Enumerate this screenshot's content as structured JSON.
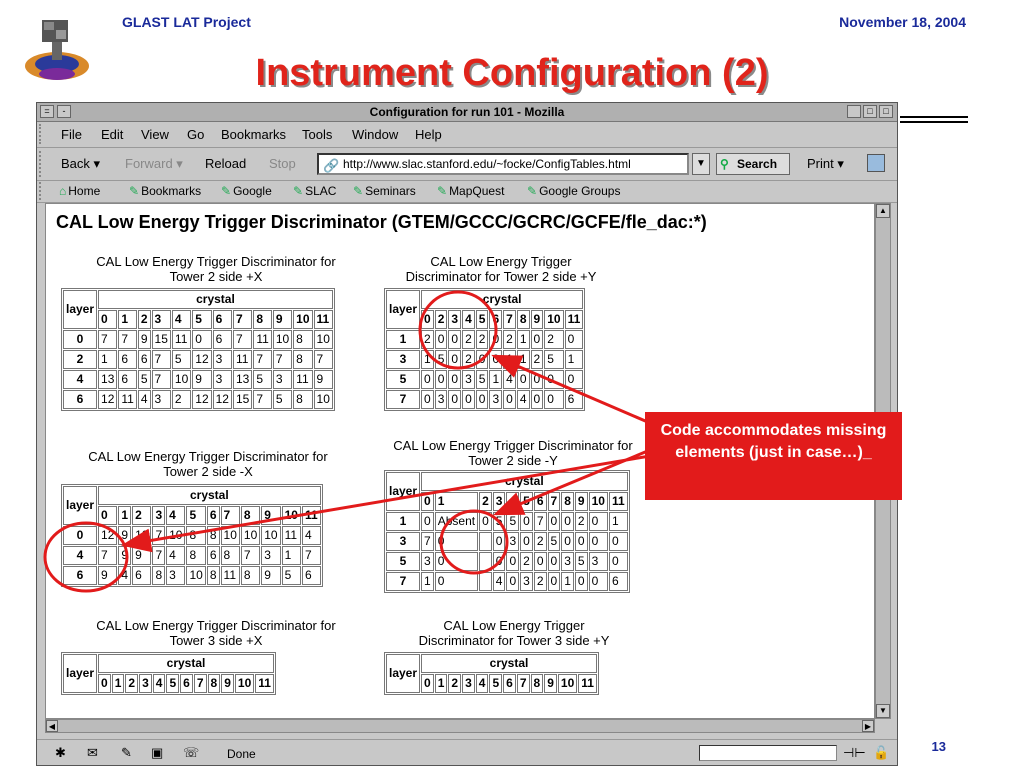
{
  "slide": {
    "left_header": "GLAST LAT Project",
    "right_header": "November 18, 2004",
    "title": "Instrument Configuration (2)",
    "page_number": "13",
    "callout": "Code accommodates missing elements (just in case…)_",
    "accent_color": "#e21b1b"
  },
  "browser": {
    "window_title": "Configuration for run 101 - Mozilla",
    "menu": [
      "File",
      "Edit",
      "View",
      "Go",
      "Bookmarks",
      "Tools",
      "Window",
      "Help"
    ],
    "nav": {
      "back": "Back",
      "forward": "Forward",
      "reload": "Reload",
      "stop": "Stop",
      "print": "Print"
    },
    "url": "http://www.slac.stanford.edu/~focke/ConfigTables.html",
    "search_label": "Search",
    "bookmarks": [
      "Home",
      "Bookmarks",
      "Google",
      "SLAC",
      "Seminars",
      "MapQuest",
      "Google Groups"
    ],
    "status": "Done"
  },
  "page": {
    "heading": "CAL Low Energy Trigger Discriminator (GTEM/GCCC/GCRC/GCFE/fle_dac:*)",
    "layer_label": "layer",
    "crystal_label": "crystal",
    "absent_label": "Absent",
    "tables": [
      {
        "caption": [
          "CAL Low Energy Trigger Discriminator for",
          "Tower 2 side +X"
        ],
        "columns": [
          "0",
          "1",
          "2",
          "3",
          "4",
          "5",
          "6",
          "7",
          "8",
          "9",
          "10",
          "11"
        ],
        "rows": [
          {
            "layer": "0",
            "values": [
              "7",
              "7",
              "9",
              "15",
              "11",
              "0",
              "6",
              "7",
              "11",
              "10",
              "8",
              "10"
            ]
          },
          {
            "layer": "2",
            "values": [
              "1",
              "6",
              "6",
              "7",
              "5",
              "12",
              "3",
              "11",
              "7",
              "7",
              "8",
              "7"
            ]
          },
          {
            "layer": "4",
            "values": [
              "13",
              "6",
              "5",
              "7",
              "10",
              "9",
              "3",
              "13",
              "5",
              "3",
              "11",
              "9"
            ]
          },
          {
            "layer": "6",
            "values": [
              "12",
              "11",
              "4",
              "3",
              "2",
              "12",
              "12",
              "15",
              "7",
              "5",
              "8",
              "10"
            ]
          }
        ]
      },
      {
        "caption": [
          "CAL Low Energy Trigger",
          "Discriminator for Tower 2 side +Y"
        ],
        "columns": [
          "0",
          "2",
          "3",
          "4",
          "5",
          "6",
          "7",
          "8",
          "9",
          "10",
          "11"
        ],
        "rows": [
          {
            "layer": "1",
            "values": [
              "2",
              "0",
              "0",
              "2",
              "2",
              "0",
              "2",
              "1",
              "0",
              "2",
              "0"
            ]
          },
          {
            "layer": "3",
            "values": [
              "1",
              "5",
              "0",
              "2",
              "0",
              "0",
              "1",
              "1",
              "2",
              "5",
              "1"
            ]
          },
          {
            "layer": "5",
            "values": [
              "0",
              "0",
              "0",
              "3",
              "5",
              "1",
              "4",
              "0",
              "0",
              "0",
              "0"
            ]
          },
          {
            "layer": "7",
            "values": [
              "0",
              "3",
              "0",
              "0",
              "0",
              "3",
              "0",
              "4",
              "0",
              "0",
              "6"
            ]
          }
        ]
      },
      {
        "caption": [
          "CAL Low Energy Trigger Discriminator for",
          "Tower 2 side -X"
        ],
        "columns": [
          "0",
          "1",
          "2",
          "3",
          "4",
          "5",
          "6",
          "7",
          "8",
          "9",
          "10",
          "11"
        ],
        "rows": [
          {
            "layer": "0",
            "values": [
              "12",
              "9",
              "10",
              "7",
              "10",
              "8",
              "8",
              "10",
              "10",
              "10",
              "11",
              "4"
            ]
          },
          {
            "layer": "4",
            "values": [
              "7",
              "9",
              "9",
              "7",
              "4",
              "8",
              "6",
              "8",
              "7",
              "3",
              "1",
              "7"
            ]
          },
          {
            "layer": "6",
            "values": [
              "9",
              "4",
              "6",
              "8",
              "3",
              "10",
              "8",
              "11",
              "8",
              "9",
              "5",
              "6"
            ]
          }
        ]
      },
      {
        "caption": [
          "CAL Low Energy Trigger Discriminator for",
          "Tower 2 side -Y"
        ],
        "columns": [
          "0",
          "1",
          "2",
          "3",
          "4",
          "5",
          "6",
          "7",
          "8",
          "9",
          "10",
          "11"
        ],
        "rows": [
          {
            "layer": "1",
            "values": [
              "0",
              "Absent",
              "0",
              "5",
              "5",
              "0",
              "7",
              "0",
              "0",
              "2",
              "0",
              "1"
            ]
          },
          {
            "layer": "3",
            "values": [
              "7",
              "0",
              "",
              "0",
              "3",
              "0",
              "2",
              "5",
              "0",
              "0",
              "0",
              "0"
            ]
          },
          {
            "layer": "5",
            "values": [
              "3",
              "0",
              "",
              "0",
              "0",
              "2",
              "0",
              "0",
              "3",
              "5",
              "3",
              "0"
            ]
          },
          {
            "layer": "7",
            "values": [
              "1",
              "0",
              "",
              "4",
              "0",
              "3",
              "2",
              "0",
              "1",
              "0",
              "0",
              "6"
            ]
          }
        ]
      },
      {
        "caption": [
          "CAL Low Energy Trigger Discriminator for",
          "Tower 3 side +X"
        ],
        "columns": [
          "0",
          "1",
          "2",
          "3",
          "4",
          "5",
          "6",
          "7",
          "8",
          "9",
          "10",
          "11"
        ],
        "rows": []
      },
      {
        "caption": [
          "CAL Low Energy Trigger",
          "Discriminator for Tower 3 side +Y"
        ],
        "columns": [
          "0",
          "1",
          "2",
          "3",
          "4",
          "5",
          "6",
          "7",
          "8",
          "9",
          "10",
          "11"
        ],
        "rows": []
      }
    ]
  }
}
